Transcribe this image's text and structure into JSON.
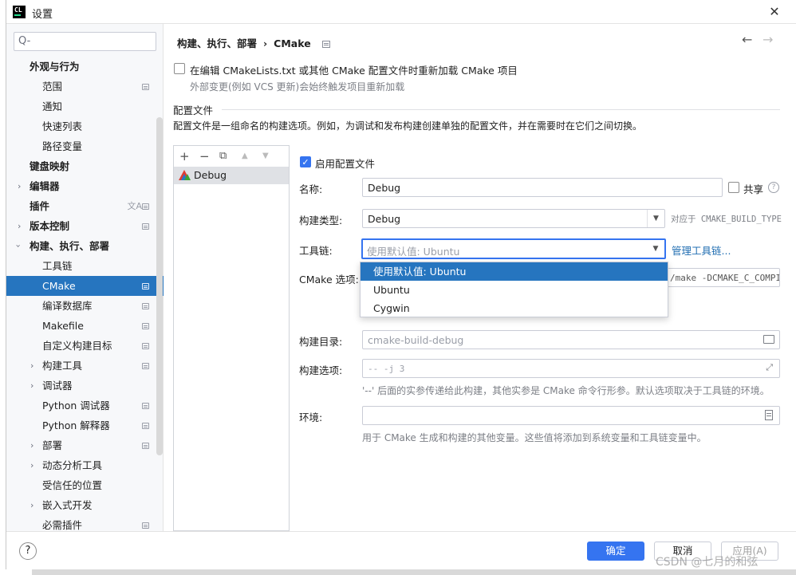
{
  "window": {
    "title": "设置",
    "logo_text": "CL"
  },
  "search": {
    "placeholder": "Q-"
  },
  "sidebar": {
    "items": [
      {
        "label": "外观与行为"
      },
      {
        "label": "范围"
      },
      {
        "label": "通知"
      },
      {
        "label": "快速列表"
      },
      {
        "label": "路径变量"
      },
      {
        "label": "键盘映射"
      },
      {
        "label": "编辑器"
      },
      {
        "label": "插件"
      },
      {
        "label": "版本控制"
      },
      {
        "label": "构建、执行、部署"
      },
      {
        "label": "工具链"
      },
      {
        "label": "CMake"
      },
      {
        "label": "编译数据库"
      },
      {
        "label": "Makefile"
      },
      {
        "label": "自定义构建目标"
      },
      {
        "label": "构建工具"
      },
      {
        "label": "调试器"
      },
      {
        "label": "Python 调试器"
      },
      {
        "label": "Python 解释器"
      },
      {
        "label": "部署"
      },
      {
        "label": "动态分析工具"
      },
      {
        "label": "受信任的位置"
      },
      {
        "label": "嵌入式开发"
      },
      {
        "label": "必需插件"
      }
    ]
  },
  "breadcrumb": {
    "parent": "构建、执行、部署",
    "separator": "›",
    "current": "CMake"
  },
  "reload": {
    "label": "在编辑 CMakeLists.txt 或其他 CMake 配置文件时重新加载 CMake 项目",
    "hint": "外部变更(例如 VCS 更新)会始终触发项目重新加载"
  },
  "profiles_section": {
    "title": "配置文件",
    "description": "配置文件是一组命名的构建选项。例如，为调试和发布构建创建单独的配置文件，并在需要时在它们之间切换。"
  },
  "profiles": {
    "toolbar": {
      "add": "+",
      "remove": "−",
      "copy": "⧉",
      "up": "▲",
      "down": "▼"
    },
    "items": [
      {
        "name": "Debug"
      }
    ]
  },
  "form": {
    "enable_label": "启用配置文件",
    "name_label": "名称:",
    "name_value": "Debug",
    "share_label": "共享",
    "build_type_label": "构建类型:",
    "build_type_value": "Debug",
    "build_type_hint": "对应于 CMAKE_BUILD_TYPE",
    "toolchain_label": "工具链:",
    "toolchain_value": "使用默认值: Ubuntu",
    "manage_toolchains": "管理工具链...",
    "cmake_options_label": "CMake 选项:",
    "cmake_options_value": "/make -DCMAKE_C_COMPI",
    "build_dir_label": "构建目录:",
    "build_dir_value": "cmake-build-debug",
    "build_options_label": "构建选项:",
    "build_options_value": "-- -j 3",
    "build_options_hint": "'--' 后面的实参传递给此构建，其他实参是 CMake 命令行形参。默认选项取决于工具链的环境。",
    "env_label": "环境:",
    "env_value": "",
    "env_hint": "用于 CMake 生成和构建的其他变量。这些值将添加到系统变量和工具链变量中。"
  },
  "toolchain_dropdown": {
    "options": [
      {
        "label": "使用默认值: Ubuntu"
      },
      {
        "label": "Ubuntu"
      },
      {
        "label": "Cygwin"
      }
    ]
  },
  "footer": {
    "help": "?",
    "ok": "确定",
    "cancel": "取消",
    "apply": "应用(A)"
  },
  "watermark": "CSDN @七月的和弦",
  "colors": {
    "accent": "#3574f0",
    "selection": "#2675bf",
    "link": "#2470b3"
  }
}
